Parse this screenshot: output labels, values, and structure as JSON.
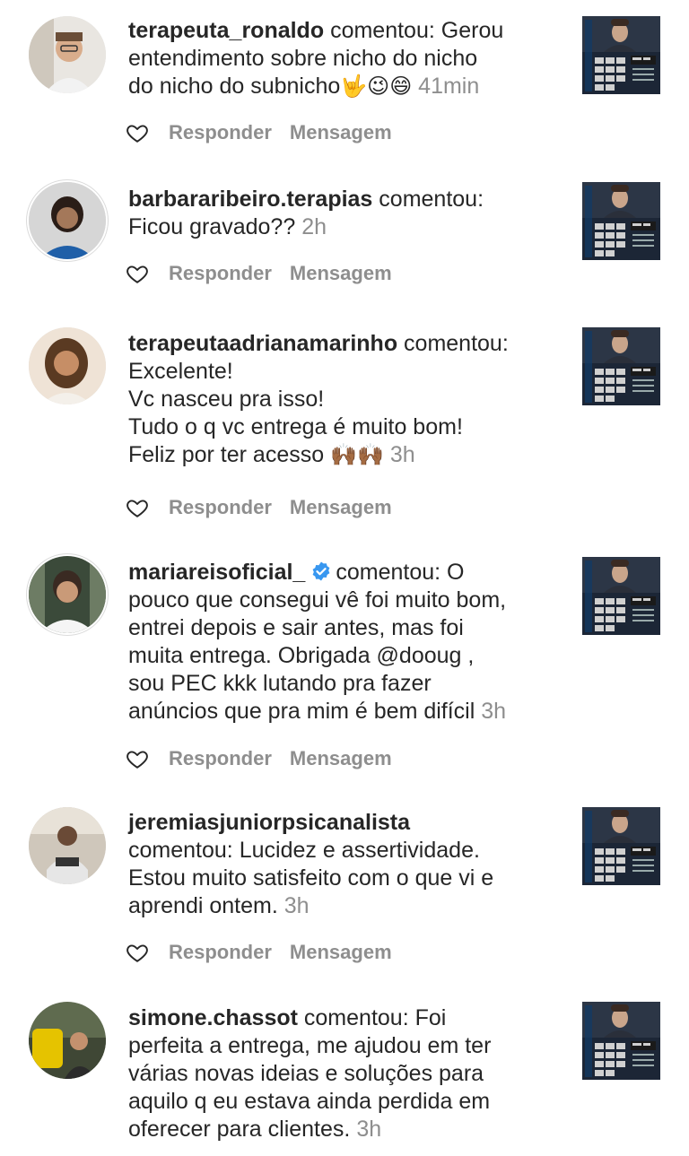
{
  "actions": {
    "reply_label": "Responder",
    "message_label": "Mensagem",
    "like_icon": "heart-outline-icon"
  },
  "colors": {
    "text": "#262626",
    "muted": "#8e8e8e",
    "verified": "#3897f0"
  },
  "comments": [
    {
      "username": "terapeuta_ronaldo",
      "verb": "comentou:",
      "lines": [
        "Gerou",
        "entendimento sobre nicho do nicho",
        "do nicho do subnicho"
      ],
      "emojis": "🤟😉😄",
      "time": "41min"
    },
    {
      "username": "barbararibeiro.terapias",
      "verb": "comentou:",
      "lines": [
        "Ficou gravado??"
      ],
      "time": "2h"
    },
    {
      "username": "terapeutaadrianamarinho",
      "verb": "comentou:",
      "lines": [
        "Excelente!",
        "Vc nasceu pra isso!",
        "Tudo o q vc entrega é muito bom!",
        "Feliz por ter acesso"
      ],
      "emojis": "🙌🏾🙌🏾",
      "time": "3h"
    },
    {
      "username": "mariareisoficial_",
      "verified": true,
      "verb": "comentou:",
      "lines": [
        "O",
        "pouco que consegui vê foi muito bom,",
        "entrei depois e sair antes, mas foi",
        "muita entrega. Obrigada @dooug ,",
        "sou PEC kkk lutando pra fazer",
        "anúncios que pra mim é bem difícil"
      ],
      "time": "3h"
    },
    {
      "username": "jeremiasjuniorpsicanalista",
      "verb": "comentou:",
      "lines": [
        "Lucidez e assertividade.",
        "Estou muito satisfeito com o que vi e",
        "aprendi ontem."
      ],
      "time": "3h"
    },
    {
      "username": "simone.chassot",
      "verb": "comentou:",
      "lines": [
        "Foi",
        "perfeita a entrega, me ajudou em ter",
        "várias novas ideias e soluções para",
        "aquilo q eu estava ainda perdida em",
        "oferecer para clientes."
      ],
      "time": "3h"
    }
  ]
}
